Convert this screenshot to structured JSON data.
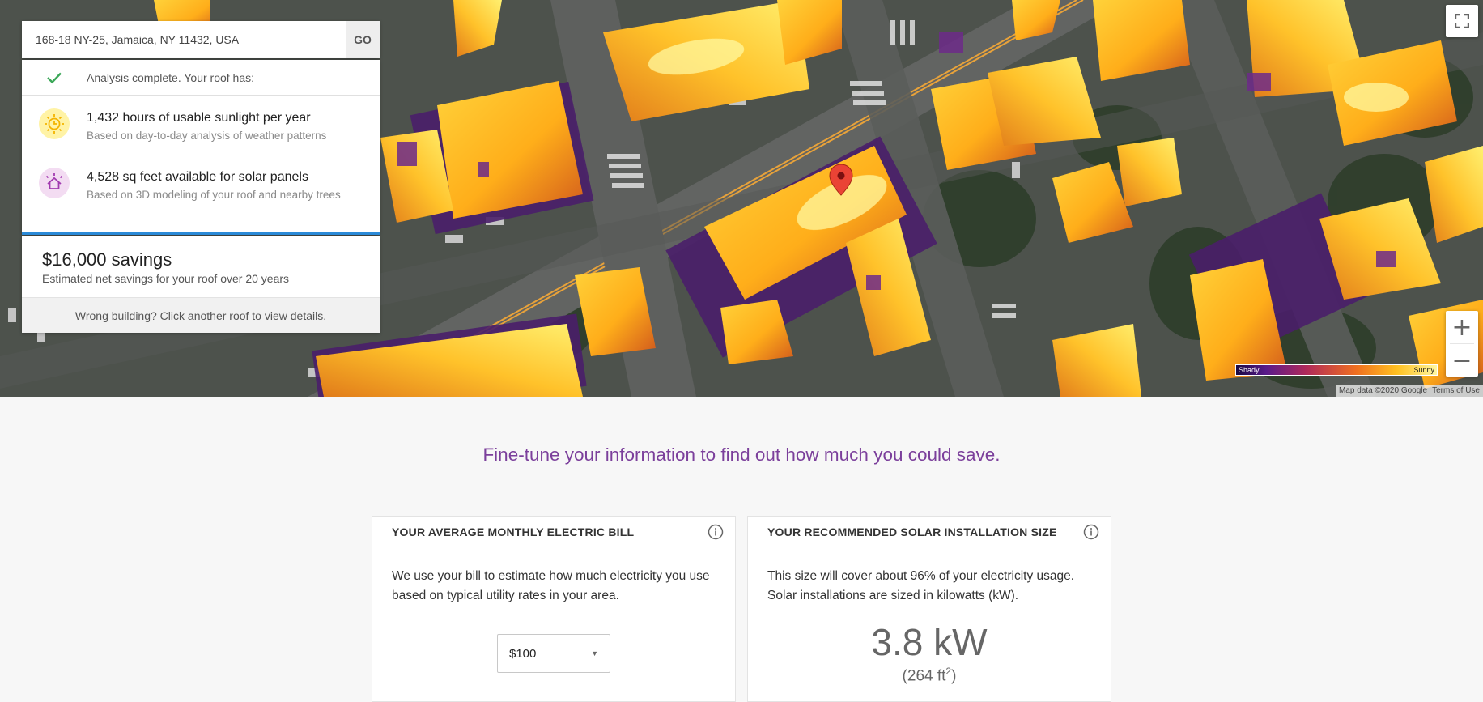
{
  "search": {
    "address": "168-18 NY-25, Jamaica, NY 11432, USA",
    "go_label": "GO"
  },
  "analysis": {
    "status": "Analysis complete. Your roof has:",
    "facts": [
      {
        "icon": "sun-clock-icon",
        "title": "1,432 hours of usable sunlight per year",
        "subtitle": "Based on day-to-day analysis of weather patterns"
      },
      {
        "icon": "house-icon",
        "title": "4,528 sq feet available for solar panels",
        "subtitle": "Based on 3D modeling of your roof and nearby trees"
      }
    ]
  },
  "savings": {
    "amount": "$16,000 savings",
    "subtitle": "Estimated net savings for your roof over 20 years",
    "wrong_building": "Wrong building? Click another roof to view details."
  },
  "map": {
    "legend_low": "Shady",
    "legend_high": "Sunny",
    "attribution": "Map data ©2020 Google",
    "terms": "Terms of Use",
    "zoom_in": "+",
    "zoom_out": "−"
  },
  "fine_tune": "Fine-tune your information to find out how much you could save.",
  "bill_panel": {
    "title": "YOUR AVERAGE MONTHLY ELECTRIC BILL",
    "description": "We use your bill to estimate how much electricity you use based on typical utility rates in your area.",
    "selected": "$100"
  },
  "size_panel": {
    "title": "YOUR RECOMMENDED SOLAR INSTALLATION SIZE",
    "description": "This size will cover about 96% of your electricity usage. Solar installations are sized in kilowatts (kW).",
    "size": "3.8 kW",
    "area_prefix": "(264 ft",
    "area_sup": "2",
    "area_suffix": ")"
  },
  "colors": {
    "accent_purple": "#7b3f9b",
    "accent_blue": "#2b8ad8",
    "check_green": "#3aa757"
  }
}
